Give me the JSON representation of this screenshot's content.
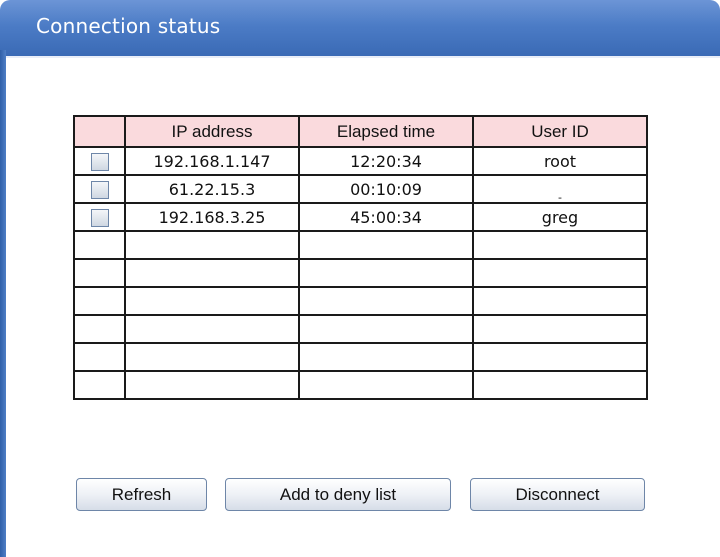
{
  "header": {
    "title": "Connection status"
  },
  "table": {
    "columns": [
      "",
      "IP address",
      "Elapsed time",
      "User ID"
    ],
    "rows": [
      {
        "ip": "192.168.1.147",
        "time": "12:20:34",
        "user": "root"
      },
      {
        "ip": "61.22.15.3",
        "time": "00:10:09",
        "user": "-"
      },
      {
        "ip": "192.168.3.25",
        "time": "45:00:34",
        "user": "greg"
      },
      {
        "ip": "",
        "time": "",
        "user": ""
      },
      {
        "ip": "",
        "time": "",
        "user": ""
      },
      {
        "ip": "",
        "time": "",
        "user": ""
      },
      {
        "ip": "",
        "time": "",
        "user": ""
      },
      {
        "ip": "",
        "time": "",
        "user": ""
      },
      {
        "ip": "",
        "time": "",
        "user": ""
      }
    ]
  },
  "buttons": {
    "refresh": "Refresh",
    "deny": "Add to deny list",
    "disconnect": "Disconnect"
  },
  "colors": {
    "header_blue": "#4c7cc6",
    "table_header_pink": "#fadadd"
  }
}
